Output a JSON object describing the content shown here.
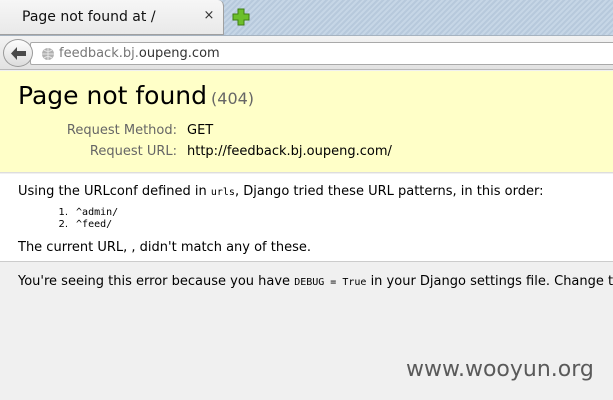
{
  "browser": {
    "tab_title": "Page not found at /",
    "close_glyph": "×",
    "url_prefix": "feedback.bj.",
    "url_domain": "oupeng.com"
  },
  "error": {
    "title": "Page not found",
    "code": "(404)",
    "request_method_label": "Request Method:",
    "request_method": "GET",
    "request_url_label": "Request URL:",
    "request_url": "http://feedback.bj.oupeng.com/"
  },
  "info": {
    "urlconf_prefix": "Using the URLconf defined in ",
    "urlconf_name": "urls",
    "urlconf_suffix": ", Django tried these URL patterns, in this order:",
    "patterns": [
      {
        "num": "1.",
        "pattern": "^admin/"
      },
      {
        "num": "2.",
        "pattern": "^feed/"
      }
    ],
    "no_match": "The current URL, , didn't match any of these."
  },
  "explanation": {
    "prefix": "You're seeing this error because you have ",
    "code": "DEBUG = True",
    "suffix": " in your Django settings file. Change that"
  },
  "watermark": "www.wooyun.org"
}
